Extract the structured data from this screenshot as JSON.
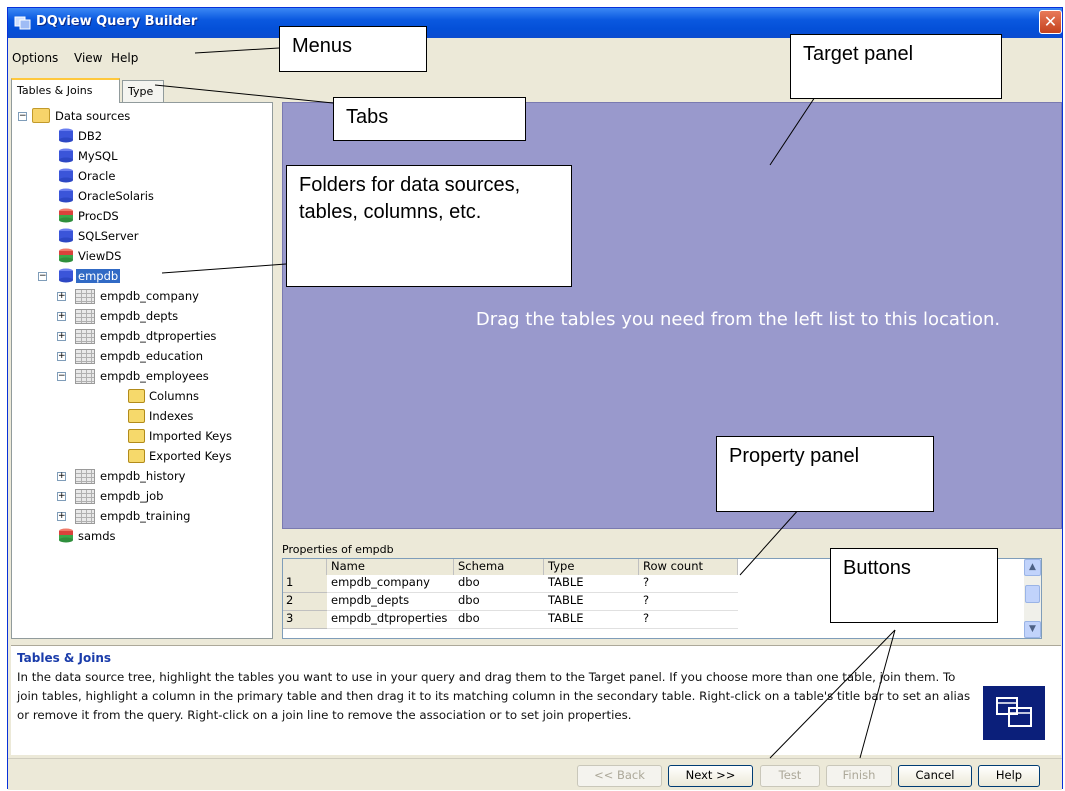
{
  "window": {
    "title": "DQview Query Builder",
    "close_glyph": "✕"
  },
  "menu": [
    "Options",
    "View",
    "Help"
  ],
  "tabs": [
    "Tables & Joins",
    "Type"
  ],
  "tree": {
    "root": "Data sources",
    "sources": [
      "DB2",
      "MySQL",
      "Oracle",
      "OracleSolaris",
      "ProcDS",
      "SQLServer",
      "ViewDS"
    ],
    "selected": "empdb",
    "tables_before": [
      "empdb_company",
      "empdb_depts",
      "empdb_dtproperties",
      "empdb_education"
    ],
    "expanded_table": "empdb_employees",
    "folders": [
      "Columns",
      "Indexes",
      "Imported Keys",
      "Exported Keys"
    ],
    "tables_after": [
      "empdb_history",
      "empdb_job",
      "empdb_training"
    ],
    "last_source": "samds"
  },
  "target": {
    "message": "Drag the tables you need from the left list to this location."
  },
  "properties": {
    "title": "Properties of empdb",
    "columns": [
      "Name",
      "Schema",
      "Type",
      "Row count"
    ],
    "rows": [
      [
        "1",
        "empdb_company",
        "dbo",
        "TABLE",
        "?"
      ],
      [
        "2",
        "empdb_depts",
        "dbo",
        "TABLE",
        "?"
      ],
      [
        "3",
        "empdb_dtproperties",
        "dbo",
        "TABLE",
        "?"
      ]
    ]
  },
  "help": {
    "title": "Tables & Joins",
    "body": "In the data source tree, highlight the tables you want to use in your query and drag them to the Target panel. If you choose more than one table, join them. To join tables, highlight a column in the primary table and then drag it to its matching column in the secondary table. Right-click on a table's title bar to set an alias or remove it from the query. Right-click on a join line to remove the association or to set join properties."
  },
  "buttons": {
    "back": "<< Back",
    "next": "Next >>",
    "test": "Test",
    "finish": "Finish",
    "cancel": "Cancel",
    "help": "Help"
  },
  "callouts": {
    "menus": "Menus",
    "tabs": "Tabs",
    "target": "Target panel",
    "folders": "Folders for data sources, tables, columns, etc.",
    "property": "Property panel",
    "buttons": "Buttons"
  }
}
